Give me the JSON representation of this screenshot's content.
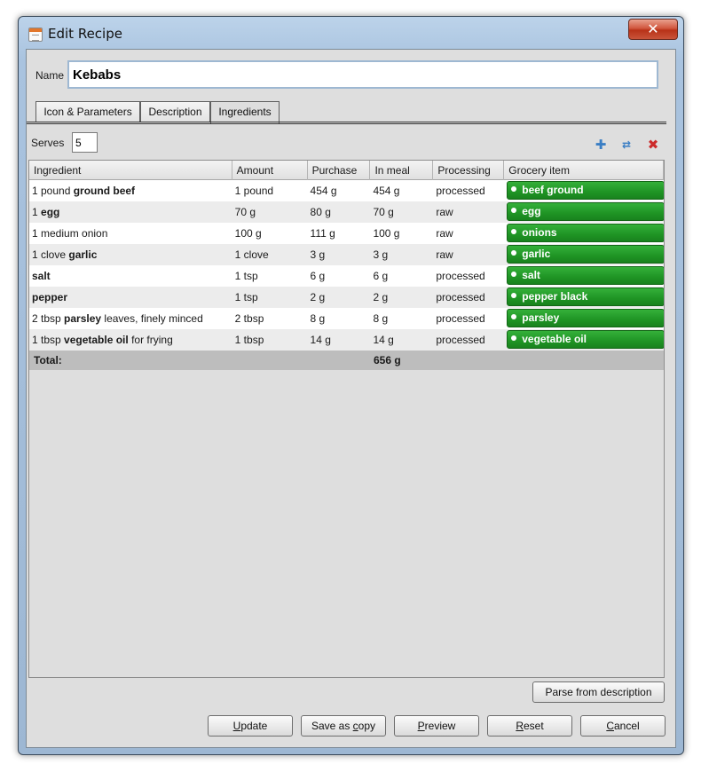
{
  "window": {
    "title": "Edit Recipe",
    "close_glyph": "✕"
  },
  "name": {
    "label": "Name",
    "value": "Kebabs"
  },
  "tabs": [
    {
      "label": "Icon & Parameters"
    },
    {
      "label": "Description"
    },
    {
      "label": "Ingredients",
      "active": true
    }
  ],
  "serves": {
    "label": "Serves",
    "value": "5"
  },
  "toolbar": {
    "add_icon": "plus-icon",
    "refresh_icon": "refresh-icon",
    "delete_icon": "delete-icon"
  },
  "table": {
    "columns": [
      "Ingredient",
      "Amount",
      "Purchase",
      "In meal",
      "Processing",
      "Grocery item"
    ],
    "rows": [
      {
        "pre": "1 pound ",
        "bold": "ground beef",
        "post": "",
        "amount": "1 pound",
        "purchase": "454 g",
        "in_meal": "454 g",
        "processing": "processed",
        "grocery": "beef ground"
      },
      {
        "pre": "1 ",
        "bold": "egg",
        "post": "",
        "amount": "70 g",
        "purchase": "80 g",
        "in_meal": "70 g",
        "processing": "raw",
        "grocery": "egg"
      },
      {
        "pre": "1 medium onion",
        "bold": "",
        "post": "",
        "amount": "100 g",
        "purchase": "111 g",
        "in_meal": "100 g",
        "processing": "raw",
        "grocery": "onions"
      },
      {
        "pre": "1 clove ",
        "bold": "garlic",
        "post": "",
        "amount": "1 clove",
        "purchase": "3 g",
        "in_meal": "3 g",
        "processing": "raw",
        "grocery": "garlic"
      },
      {
        "pre": "",
        "bold": "salt",
        "post": "",
        "amount": "1 tsp",
        "purchase": "6 g",
        "in_meal": "6 g",
        "processing": "processed",
        "grocery": "salt"
      },
      {
        "pre": "",
        "bold": "pepper",
        "post": "",
        "amount": "1 tsp",
        "purchase": "2 g",
        "in_meal": "2 g",
        "processing": "processed",
        "grocery": "pepper black"
      },
      {
        "pre": "2 tbsp ",
        "bold": "parsley",
        "post": " leaves, finely minced",
        "amount": "2 tbsp",
        "purchase": "8 g",
        "in_meal": "8 g",
        "processing": "processed",
        "grocery": "parsley"
      },
      {
        "pre": "1 tbsp ",
        "bold": "vegetable oil",
        "post": " for frying",
        "amount": "1 tbsp",
        "purchase": "14 g",
        "in_meal": "14 g",
        "processing": "processed",
        "grocery": "vegetable oil"
      }
    ],
    "total": {
      "label": "Total:",
      "in_meal": "656 g"
    }
  },
  "buttons": {
    "parse": "Parse from description",
    "update": {
      "mnemonic": "U",
      "rest": "pdate"
    },
    "save_copy": {
      "pre": "Save as ",
      "mnemonic": "c",
      "rest": "opy"
    },
    "preview": {
      "mnemonic": "P",
      "rest": "review"
    },
    "reset": {
      "mnemonic": "R",
      "rest": "eset"
    },
    "cancel": {
      "mnemonic": "C",
      "rest": "ancel"
    }
  },
  "colors": {
    "grocery_badge": "#1f9424",
    "accent_blue": "#3a7ec4",
    "delete_red": "#cc2b2b"
  }
}
